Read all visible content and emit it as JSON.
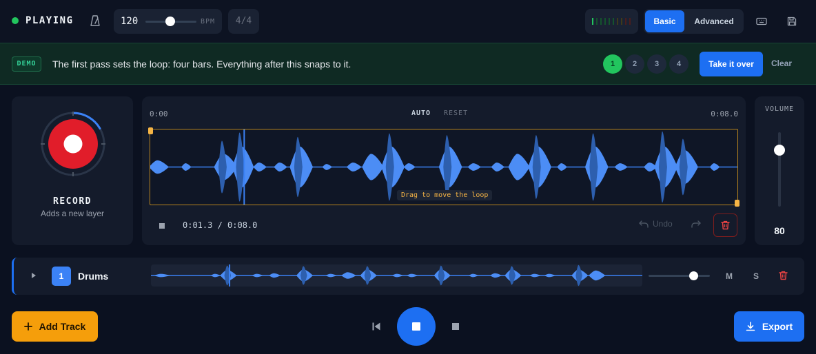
{
  "header": {
    "status_label": "PLAYING",
    "status_color": "#22c55e",
    "bpm_value": "120",
    "bpm_unit": "BPM",
    "bpm_level": 0.5,
    "time_signature": "4/4",
    "mode_basic": "Basic",
    "mode_advanced": "Advanced",
    "icons": [
      "metronome-icon",
      "keyboard-icon",
      "save-icon"
    ]
  },
  "banner": {
    "badge": "DEMO",
    "message": "The first pass sets the loop: four bars. Everything after this snaps to it.",
    "steps": [
      "1",
      "2",
      "3",
      "4"
    ],
    "active_step": "1",
    "take_over_label": "Take it over",
    "clear_label": "Clear"
  },
  "record": {
    "label": "RECORD",
    "sublabel": "Adds a new layer",
    "accent_color": "#e11d2a"
  },
  "waveform": {
    "time_start": "0:00",
    "time_end": "0:08.0",
    "auto_label": "AUTO",
    "reset_label": "RESET",
    "tooltip": "Drag to move the loop",
    "position_text": "0:01.3 / 0:08.0",
    "undo_label": "Undo",
    "playhead_fraction": 0.16
  },
  "volume": {
    "label": "VOLUME",
    "value": "80"
  },
  "tracks": [
    {
      "number": "1",
      "name": "Drums",
      "mute_label": "M",
      "solo_label": "S",
      "volume_level": 0.8,
      "color": "#3b82f6"
    }
  ],
  "footer": {
    "add_track_label": "Add Track",
    "export_label": "Export",
    "add_color": "#f59e0b",
    "accent_color": "#1d6ff2"
  }
}
